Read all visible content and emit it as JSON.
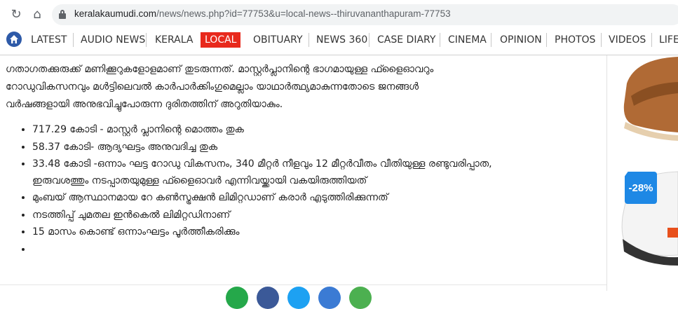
{
  "browser": {
    "url_host": "keralakaumudi.com",
    "url_path": "/news/news.php?id=77753&u=local-news--thiruvananthapuram-77753"
  },
  "nav": {
    "items": [
      {
        "label": "LATEST"
      },
      {
        "label": "AUDIO NEWS"
      },
      {
        "label": "KERALA"
      },
      {
        "label": "LOCAL"
      },
      {
        "label": "OBITUARY"
      },
      {
        "label": "NEWS 360"
      },
      {
        "label": "CASE DIARY"
      },
      {
        "label": "CINEMA"
      },
      {
        "label": "OPINION"
      },
      {
        "label": "PHOTOS"
      },
      {
        "label": "VIDEOS"
      },
      {
        "label": "LIFE"
      }
    ],
    "active_color": "#e8291c"
  },
  "article": {
    "paragraph_lines": [
      "ഗതാഗതക്കുരുക്ക് മണിക്കൂറുകളോളമാണ് തുടരുന്നത്. മാസ്റ്റർപ്ലാനിന്റെ ഭാഗമായുള്ള ഫ്ളൈഓവറും",
      "റോഡുവികസനവും മൾട്ടിലെവൽ കാർപാർക്കിംഗുമെല്ലാം യാഥാർത്ഥ്യമാകുന്നതോടെ ജനങ്ങൾ",
      "വർഷങ്ങളായി അനുഭവിച്ചുപോരുന്ന ദുരിതത്തിന് അറുതിയാകും."
    ],
    "bullets": [
      "717.29 കോടി - മാസ്റ്റർ പ്ലാനിന്റെ മൊത്തം തുക",
      "58.37 കോടി- ആദ്യഘട്ടം അനുവദിച്ച തുക",
      "33.48 കോടി -ഒന്നാം ഘട്ട റോഡു വികസനം, 340 മീറ്റർ നീളവും 12 മീറ്റർവീതം വീതിയുള്ള രണ്ടുവരിപ്പാത,",
      "ഇരുവശത്തും നടപ്പാതയുമുള്ള ഫ്ളൈഓവർ എന്നിവയ്ക്കായി വകയിരുത്തിയത്",
      "മുംബയ് ആസ്ഥാനമായ റേ കൺസ്ട്രക്ഷൻ ലിമിറ്റഡാണ് കരാർ എടുത്തിരിക്കുന്നത്",
      "നടത്തിപ്പ് ചുമതല ഇൻകെൽ ലിമിറ്റഡിനാണ്",
      "15 മാസം കൊണ്ട് ഒന്നാംഘട്ടം പൂർത്തീകരിക്കും",
      ""
    ]
  },
  "ad": {
    "discount": "-28%",
    "badge_color": "#1e88e5"
  }
}
